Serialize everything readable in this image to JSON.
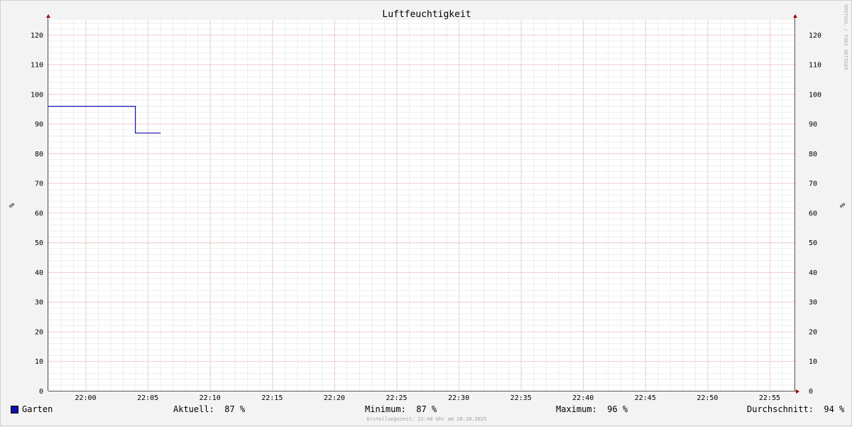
{
  "chart_data": {
    "type": "line",
    "title": "Luftfeuchtigkeit",
    "vertical_label": "%",
    "watermark": "RRDTOOL / TOBI OETIKER",
    "ylim": [
      0,
      125
    ],
    "y_ticks": [
      0,
      10,
      20,
      30,
      40,
      50,
      60,
      70,
      80,
      90,
      100,
      110,
      120
    ],
    "x_range": [
      "21:57",
      "22:57"
    ],
    "x_ticks": [
      "22:00",
      "22:05",
      "22:10",
      "22:15",
      "22:20",
      "22:25",
      "22:30",
      "22:35",
      "22:40",
      "22:45",
      "22:50",
      "22:55"
    ],
    "grid": true,
    "legend_position": "bottom",
    "series": [
      {
        "name": "Garten",
        "color": "#1010b0",
        "step": true,
        "points": [
          {
            "x": "21:57",
            "y": 96
          },
          {
            "x": "22:04",
            "y": 96
          },
          {
            "x": "22:04",
            "y": 87
          },
          {
            "x": "22:06",
            "y": 87
          }
        ]
      }
    ]
  },
  "legend": {
    "series_name": "Garten",
    "aktuell": "Aktuell:  87 %",
    "minimum": "Minimum:  87 %",
    "maximum": "Maximum:  96 %",
    "durchschnitt": "Durchschnitt:  94 %"
  },
  "footer": "Erstellungszeit: 22:48 Uhr am 28.10.2025"
}
